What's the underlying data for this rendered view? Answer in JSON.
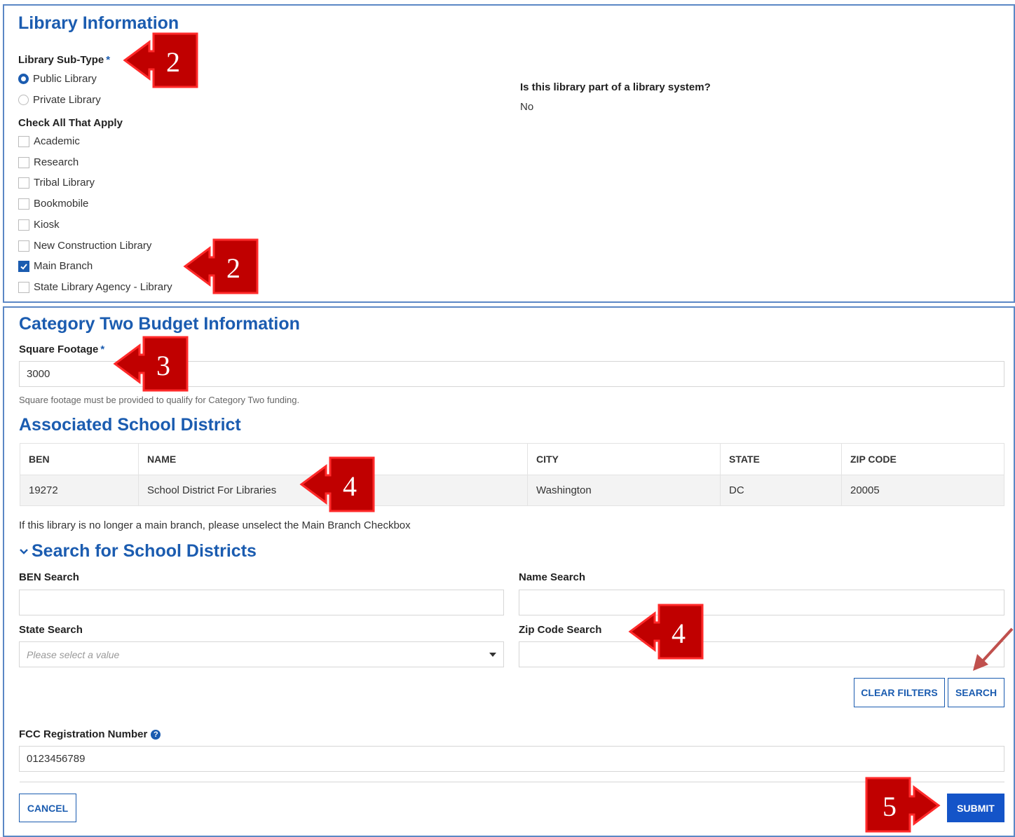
{
  "library_info": {
    "title": "Library Information",
    "subtype_label": "Library Sub-Type",
    "required_mark": "*",
    "subtypes": [
      {
        "label": "Public Library",
        "selected": true
      },
      {
        "label": "Private Library",
        "selected": false
      }
    ],
    "check_all_label": "Check All That Apply",
    "checkboxes": [
      {
        "label": "Academic",
        "checked": false
      },
      {
        "label": "Research",
        "checked": false
      },
      {
        "label": "Tribal Library",
        "checked": false
      },
      {
        "label": "Bookmobile",
        "checked": false
      },
      {
        "label": "Kiosk",
        "checked": false
      },
      {
        "label": "New Construction Library",
        "checked": false
      },
      {
        "label": "Main Branch",
        "checked": true
      },
      {
        "label": "State Library Agency - Library",
        "checked": false
      }
    ],
    "system_question": "Is this library part of a library system?",
    "system_answer": "No"
  },
  "category_two": {
    "title": "Category Two Budget Information",
    "square_footage_label": "Square Footage",
    "required_mark": "*",
    "square_footage_value": "3000",
    "square_footage_hint": "Square footage must be provided to qualify for Category Two funding."
  },
  "associated_district": {
    "title": "Associated School District",
    "columns": [
      "BEN",
      "NAME",
      "CITY",
      "STATE",
      "ZIP CODE"
    ],
    "rows": [
      [
        "19272",
        "School District For Libraries",
        "Washington",
        "DC",
        "20005"
      ]
    ],
    "note": "If this library is no longer a main branch, please unselect the Main Branch Checkbox"
  },
  "search": {
    "title": "Search for School Districts",
    "ben_label": "BEN Search",
    "ben_value": "",
    "name_label": "Name Search",
    "name_value": "",
    "state_label": "State Search",
    "state_placeholder": "Please select a value",
    "zip_label": "Zip Code Search",
    "zip_value": "",
    "clear_label": "CLEAR FILTERS",
    "search_label": "SEARCH"
  },
  "fcc": {
    "label": "FCC Registration Number",
    "value": "0123456789"
  },
  "footer": {
    "cancel_label": "CANCEL",
    "submit_label": "SUBMIT"
  },
  "annotations": {
    "step_subtype": "2",
    "step_main_branch": "2",
    "step_square_footage": "3",
    "step_district": "4",
    "step_zip": "4",
    "step_submit": "5"
  },
  "colors": {
    "accent": "#1b5cb0",
    "primary_button": "#1454c8",
    "callout_fill": "#c00000",
    "panel_border": "#5b87c5"
  }
}
